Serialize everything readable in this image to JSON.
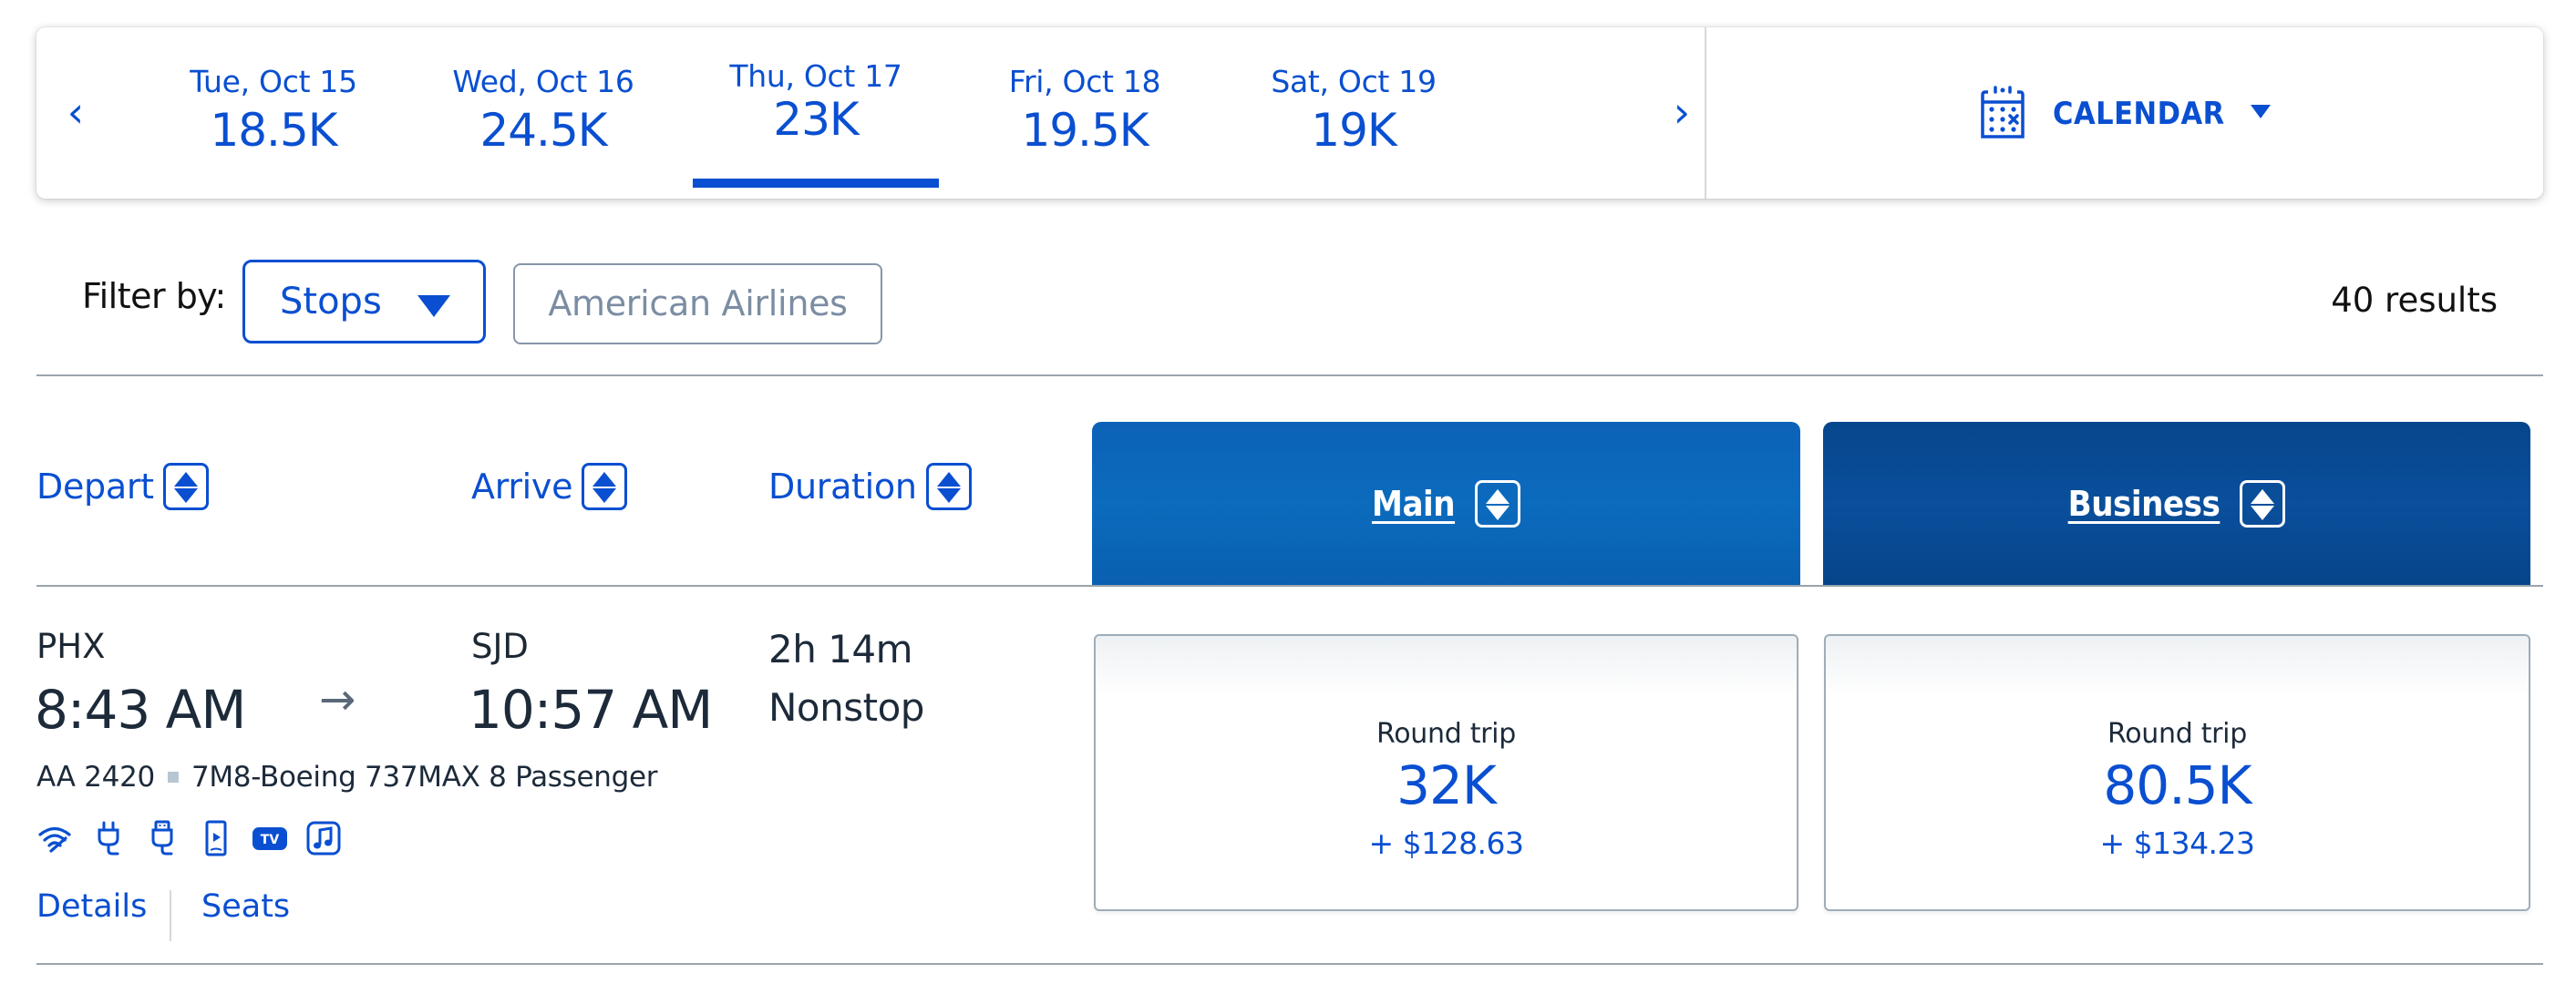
{
  "date_bar": {
    "prev_icon": "chevron-left-icon",
    "next_icon": "chevron-right-icon",
    "prev_glyph": "‹",
    "next_glyph": "›",
    "tabs": [
      {
        "label": "Tue, Oct 15",
        "price": "18.5K",
        "selected": false
      },
      {
        "label": "Wed, Oct 16",
        "price": "24.5K",
        "selected": false
      },
      {
        "label": "Thu, Oct 17",
        "price": "23K",
        "selected": true
      },
      {
        "label": "Fri, Oct 18",
        "price": "19.5K",
        "selected": false
      },
      {
        "label": "Sat, Oct 19",
        "price": "19K",
        "selected": false
      }
    ],
    "calendar": {
      "label": "CALENDAR",
      "icon": "calendar-icon",
      "caret_icon": "caret-down-icon"
    }
  },
  "filters": {
    "label": "Filter by:",
    "stops_select": {
      "value": "Stops",
      "icon": "caret-down-icon"
    },
    "airline_button": {
      "label": "American Airlines"
    },
    "results_count": "40 results"
  },
  "columns": {
    "depart": "Depart",
    "arrive": "Arrive",
    "duration": "Duration",
    "main": "Main",
    "business": "Business",
    "sort_icon": "sort-icon"
  },
  "flights": [
    {
      "origin": "PHX",
      "depart_time": "8:43 AM",
      "arrow_glyph": "→",
      "destination": "SJD",
      "arrive_time": "10:57 AM",
      "duration": "2h 14m",
      "stops": "Nonstop",
      "flight_number": "AA 2420",
      "aircraft": "7M8-Boeing 737MAX 8 Passenger",
      "amenities": [
        "wifi-icon",
        "power-outlet-icon",
        "usb-icon",
        "mobile-entertainment-icon",
        "tv-icon",
        "music-icon"
      ],
      "tv_badge": "TV",
      "links": {
        "details": "Details",
        "seats": "Seats"
      },
      "fares": {
        "main": {
          "type": "Round trip",
          "miles": "32K",
          "taxes": "+ $128.63"
        },
        "business": {
          "type": "Round trip",
          "miles": "80.5K",
          "taxes": "+ $134.23"
        }
      }
    }
  ],
  "colors": {
    "accent": "#0a4fd1",
    "main_header": "#0b66bb",
    "business_header": "#064b94",
    "text_dark": "#1c2a3a",
    "muted_border": "#8795a8"
  }
}
